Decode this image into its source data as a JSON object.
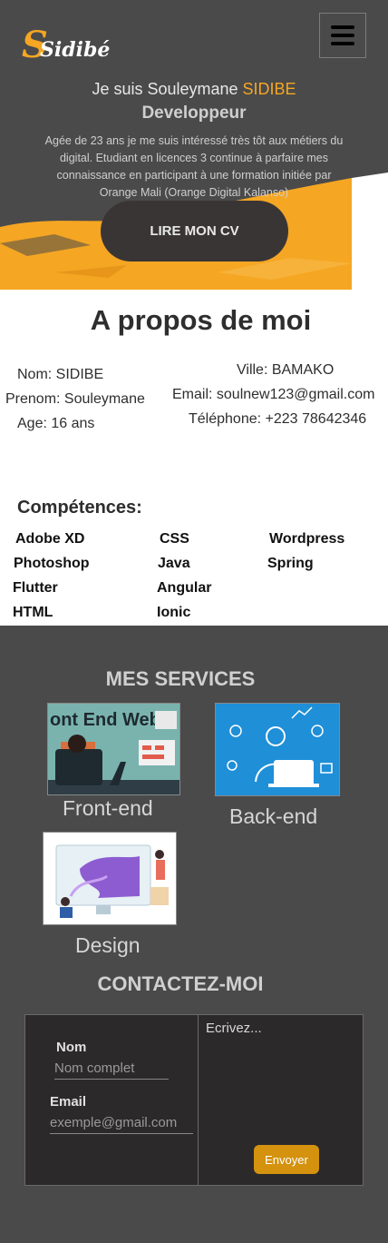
{
  "brand": {
    "logo_letter": "S",
    "logo_text": "Sidibé"
  },
  "hero": {
    "greeting": "Je suis Souleymane ",
    "lastname": "SIDIBE",
    "role": "Developpeur",
    "description": "Agée de 23 ans je me suis intéressé très tôt aux métiers du digital. Etudiant en licences 3 continue à parfaire mes connaissance en participant à une formation initiée par Orange Mali (Orange Digital Kalanso)",
    "cv_button": "LIRE MON CV"
  },
  "about": {
    "title": "A propos de moi",
    "left": [
      "Nom: SIDIBE",
      "Prenom: Souleymane",
      "Age: 16 ans"
    ],
    "right": [
      "Ville: BAMAKO",
      "Email: soulnew123@gmail.com",
      "Téléphone: +223 78642346"
    ],
    "skills_title": "Compétences:",
    "skills": [
      "Adobe XD",
      "CSS",
      "Wordpress",
      "Photoshop",
      "Java",
      "Spring",
      "Flutter",
      "Angular",
      "HTML",
      "Ionic"
    ]
  },
  "services": {
    "title": "MES SERVICES",
    "items": [
      {
        "label": "Front-end",
        "image_text": "ont End Web"
      },
      {
        "label": "Back-end"
      },
      {
        "label": "Design"
      }
    ]
  },
  "contact": {
    "title": "CONTACTEZ-MOI",
    "name_label": "Nom",
    "name_placeholder": "Nom complet",
    "email_label": "Email",
    "email_placeholder": "exemple@gmail.com",
    "message_placeholder": "Ecrivez...",
    "send_label": "Envoyer"
  },
  "colors": {
    "accent": "#f5a623",
    "background": "#4a4a4a",
    "button_dark": "#3a3535",
    "send": "#d4920f"
  }
}
